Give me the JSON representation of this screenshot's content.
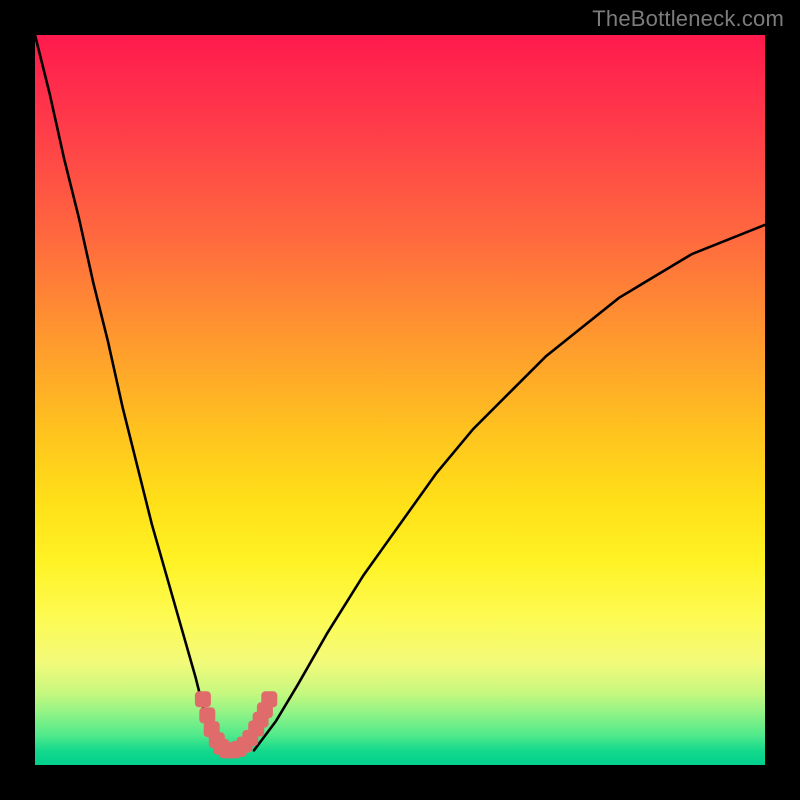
{
  "watermark": "TheBottleneck.com",
  "chart_data": {
    "type": "line",
    "title": "",
    "xlabel": "",
    "ylabel": "",
    "xlim": [
      0,
      100
    ],
    "ylim": [
      0,
      100
    ],
    "legend": false,
    "grid": false,
    "background_gradient": {
      "top": "#ff1a4d",
      "mid": "#ffe018",
      "bottom": "#00cf8d"
    },
    "series": [
      {
        "name": "left-branch",
        "color": "#000000",
        "x": [
          0,
          2,
          4,
          6,
          8,
          10,
          12,
          14,
          16,
          18,
          20,
          22,
          23,
          24,
          25
        ],
        "y": [
          100,
          92,
          83,
          75,
          66,
          58,
          49,
          41,
          33,
          26,
          19,
          12,
          8,
          5,
          2
        ]
      },
      {
        "name": "right-branch",
        "color": "#000000",
        "x": [
          30,
          33,
          36,
          40,
          45,
          50,
          55,
          60,
          65,
          70,
          75,
          80,
          85,
          90,
          95,
          100
        ],
        "y": [
          2,
          6,
          11,
          18,
          26,
          33,
          40,
          46,
          51,
          56,
          60,
          64,
          67,
          70,
          72,
          74
        ]
      },
      {
        "name": "minimum-marker",
        "color": "#e06b6b",
        "marker": "square",
        "x": [
          23,
          23.6,
          24.2,
          24.9,
          25.5,
          26.3,
          27.1,
          27.9,
          28.7,
          29.5,
          30.3,
          30.9,
          31.5,
          32.1
        ],
        "y": [
          9,
          6.8,
          4.9,
          3.4,
          2.5,
          2,
          2,
          2.2,
          2.8,
          3.7,
          5,
          6.2,
          7.5,
          9
        ]
      }
    ],
    "annotations": []
  }
}
